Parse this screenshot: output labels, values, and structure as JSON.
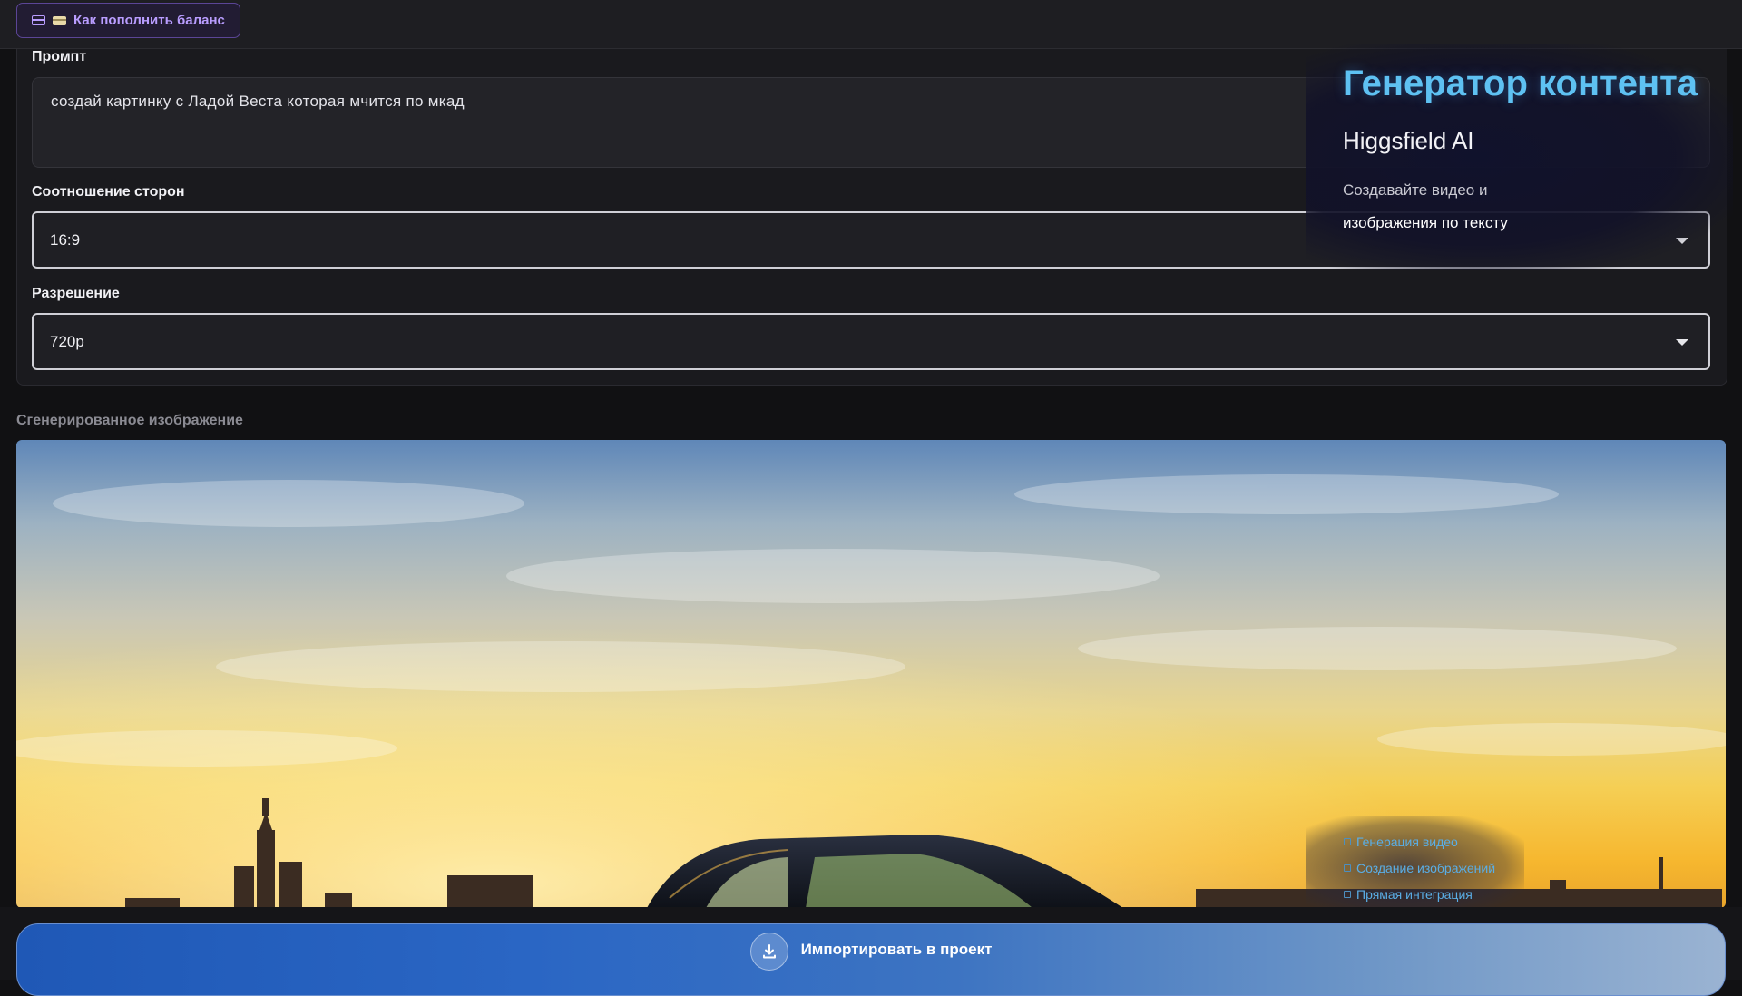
{
  "topbar": {
    "balance_button": "Как пополнить баланс"
  },
  "form": {
    "prompt_label": "Промпт",
    "prompt_value": "создай картинку с Ладой Веста которая мчится по мкад",
    "aspect_label": "Соотношение сторон",
    "aspect_value": "16:9",
    "resolution_label": "Разрешение",
    "resolution_value": "720p"
  },
  "overlay": {
    "title": "Генератор контента",
    "subtitle": "Higgsfield AI",
    "desc_line1": "Создавайте видео и",
    "desc_line2": "изображения по тексту",
    "features": [
      "Генерация видео",
      "Создание изображений",
      "Прямая интеграция"
    ]
  },
  "result": {
    "label": "Сгенерированное изображение"
  },
  "actions": {
    "import_button": "Импортировать в проект"
  },
  "colors": {
    "accent_purple": "#b99dff",
    "title_blue": "#5ec1f2",
    "button_blue": "#2a66c4"
  }
}
